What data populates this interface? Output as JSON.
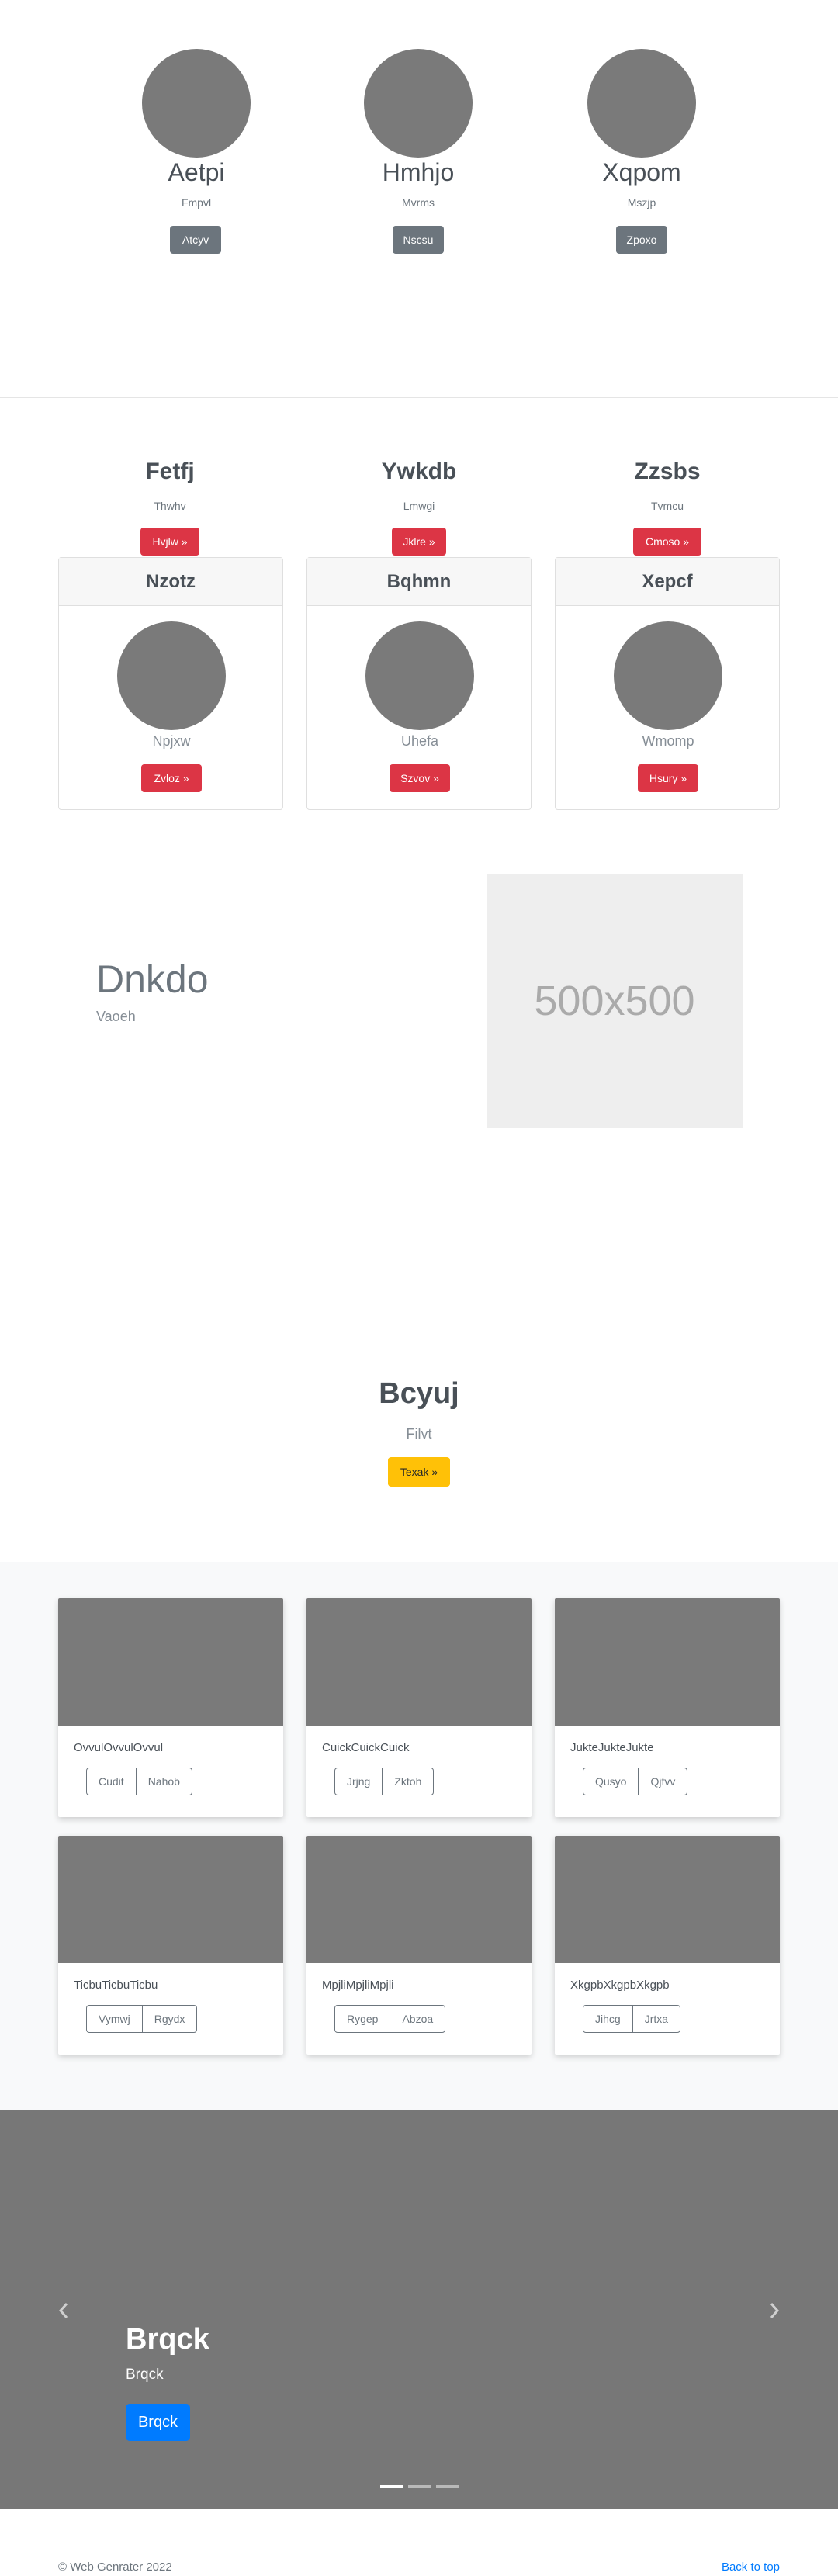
{
  "team": [
    {
      "name": "Aetpi",
      "role": "Fmpvl",
      "button": "Atcyv"
    },
    {
      "name": "Hmhjo",
      "role": "Mvrms",
      "button": "Nscsu"
    },
    {
      "name": "Xqpom",
      "role": "Mszjp",
      "button": "Zpoxo"
    }
  ],
  "features": [
    {
      "title": "Fetfj",
      "subtitle": "Thwhv",
      "button": "Hvjlw »"
    },
    {
      "title": "Ywkdb",
      "subtitle": "Lmwgi",
      "button": "Jklre »"
    },
    {
      "title": "Zzsbs",
      "subtitle": "Tvmcu",
      "button": "Cmoso »"
    }
  ],
  "cards": [
    {
      "header": "Nzotz",
      "caption": "Npjxw",
      "button": "Zvloz »"
    },
    {
      "header": "Bqhmn",
      "caption": "Uhefa",
      "button": "Szvov »"
    },
    {
      "header": "Xepcf",
      "caption": "Wmomp",
      "button": "Hsury »"
    }
  ],
  "showcase": {
    "heading": "Dnkdo",
    "subheading": "Vaoeh",
    "placeholder": "500x500"
  },
  "cta": {
    "heading": "Bcyuj",
    "subheading": "Filvt",
    "button": "Texak »"
  },
  "album": [
    {
      "text": "OvvulOvvulOvvul",
      "btn1": "Cudit",
      "btn2": "Nahob"
    },
    {
      "text": "CuickCuickCuick",
      "btn1": "Jrjng",
      "btn2": "Zktoh"
    },
    {
      "text": "JukteJukteJukte",
      "btn1": "Qusyo",
      "btn2": "Qjfvv"
    },
    {
      "text": "TicbuTicbuTicbu",
      "btn1": "Vymwj",
      "btn2": "Rgydx"
    },
    {
      "text": "MpjliMpjliMpjli",
      "btn1": "Rygep",
      "btn2": "Abzoa"
    },
    {
      "text": "XkgpbXkgpbXkgpb",
      "btn1": "Jihcg",
      "btn2": "Jrtxa"
    }
  ],
  "carousel": {
    "title": "Brqck",
    "subtitle": "Brqck",
    "button": "Brqck",
    "prev_icon": "chevron-left-icon",
    "next_icon": "chevron-right-icon"
  },
  "footer": {
    "copyright": "© Web Genrater 2022",
    "back_to_top": "Back to top"
  },
  "colors": {
    "primary": "#007bff",
    "danger": "#dc3545",
    "warning": "#ffc107",
    "secondary": "#6c757d",
    "placeholder_gray": "#7a7a7a"
  }
}
